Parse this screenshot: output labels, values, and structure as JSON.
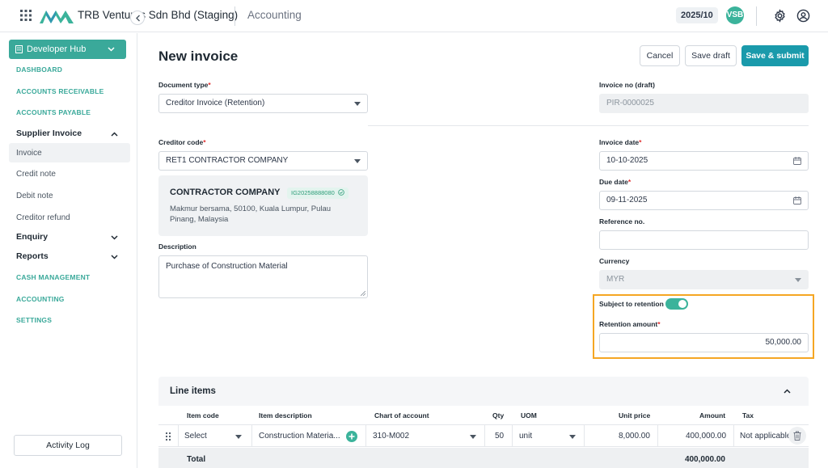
{
  "header": {
    "company": "TRB Ventures Sdn Bhd (Staging)",
    "module": "Accounting",
    "period": "2025/10",
    "avatar_initials": "VSB"
  },
  "sidebar": {
    "hub_label": "Developer Hub",
    "links": {
      "dashboard": "DASHBOARD",
      "accounts_receivable": "ACCOUNTS RECEIVABLE",
      "accounts_payable": "ACCOUNTS PAYABLE",
      "cash_management": "CASH MANAGEMENT",
      "accounting": "ACCOUNTING",
      "settings": "SETTINGS"
    },
    "supplier_invoice": {
      "label": "Supplier Invoice",
      "items": [
        "Invoice",
        "Credit note",
        "Debit note",
        "Creditor refund"
      ]
    },
    "enquiry": "Enquiry",
    "reports": "Reports",
    "activity_log": "Activity Log"
  },
  "page": {
    "title": "New invoice",
    "buttons": {
      "cancel": "Cancel",
      "save_draft": "Save draft",
      "save_submit": "Save & submit"
    }
  },
  "form": {
    "document_type": {
      "label": "Document type",
      "value": "Creditor Invoice (Retention)"
    },
    "invoice_no": {
      "label": "Invoice no (draft)",
      "value": "PIR-0000025"
    },
    "creditor_code": {
      "label": "Creditor code",
      "value": "RET1 CONTRACTOR COMPANY"
    },
    "creditor": {
      "name": "CONTRACTOR COMPANY",
      "code": "IG20258888080",
      "address": "Makmur bersama, 50100, Kuala Lumpur, Pulau Pinang, Malaysia"
    },
    "description": {
      "label": "Description",
      "value": "Purchase of Construction Material"
    },
    "invoice_date": {
      "label": "Invoice date",
      "value": "10-10-2025"
    },
    "due_date": {
      "label": "Due date",
      "value": "09-11-2025"
    },
    "reference_no": {
      "label": "Reference no.",
      "value": ""
    },
    "currency": {
      "label": "Currency",
      "value": "MYR"
    },
    "subject_to_retention": {
      "label": "Subject to retention",
      "on": true
    },
    "retention_amount": {
      "label": "Retention amount",
      "value": "50,000.00"
    }
  },
  "line_items": {
    "title": "Line items",
    "columns": {
      "item_code": "Item code",
      "item_description": "Item description",
      "chart_of_account": "Chart of account",
      "qty": "Qty",
      "uom": "UOM",
      "unit_price": "Unit price",
      "amount": "Amount",
      "tax": "Tax"
    },
    "rows": [
      {
        "item_code": "Select",
        "item_description": "Construction Materia...",
        "chart_of_account": "310-M002",
        "qty": "50",
        "uom": "unit",
        "unit_price": "8,000.00",
        "amount": "400,000.00",
        "tax": "Not applicable"
      }
    ],
    "total_label": "Total",
    "total_value": "400,000.00"
  },
  "colors": {
    "accent": "#1a9aab",
    "teal": "#3aa99a",
    "highlight_border": "#f5a623",
    "required": "#e03131"
  }
}
